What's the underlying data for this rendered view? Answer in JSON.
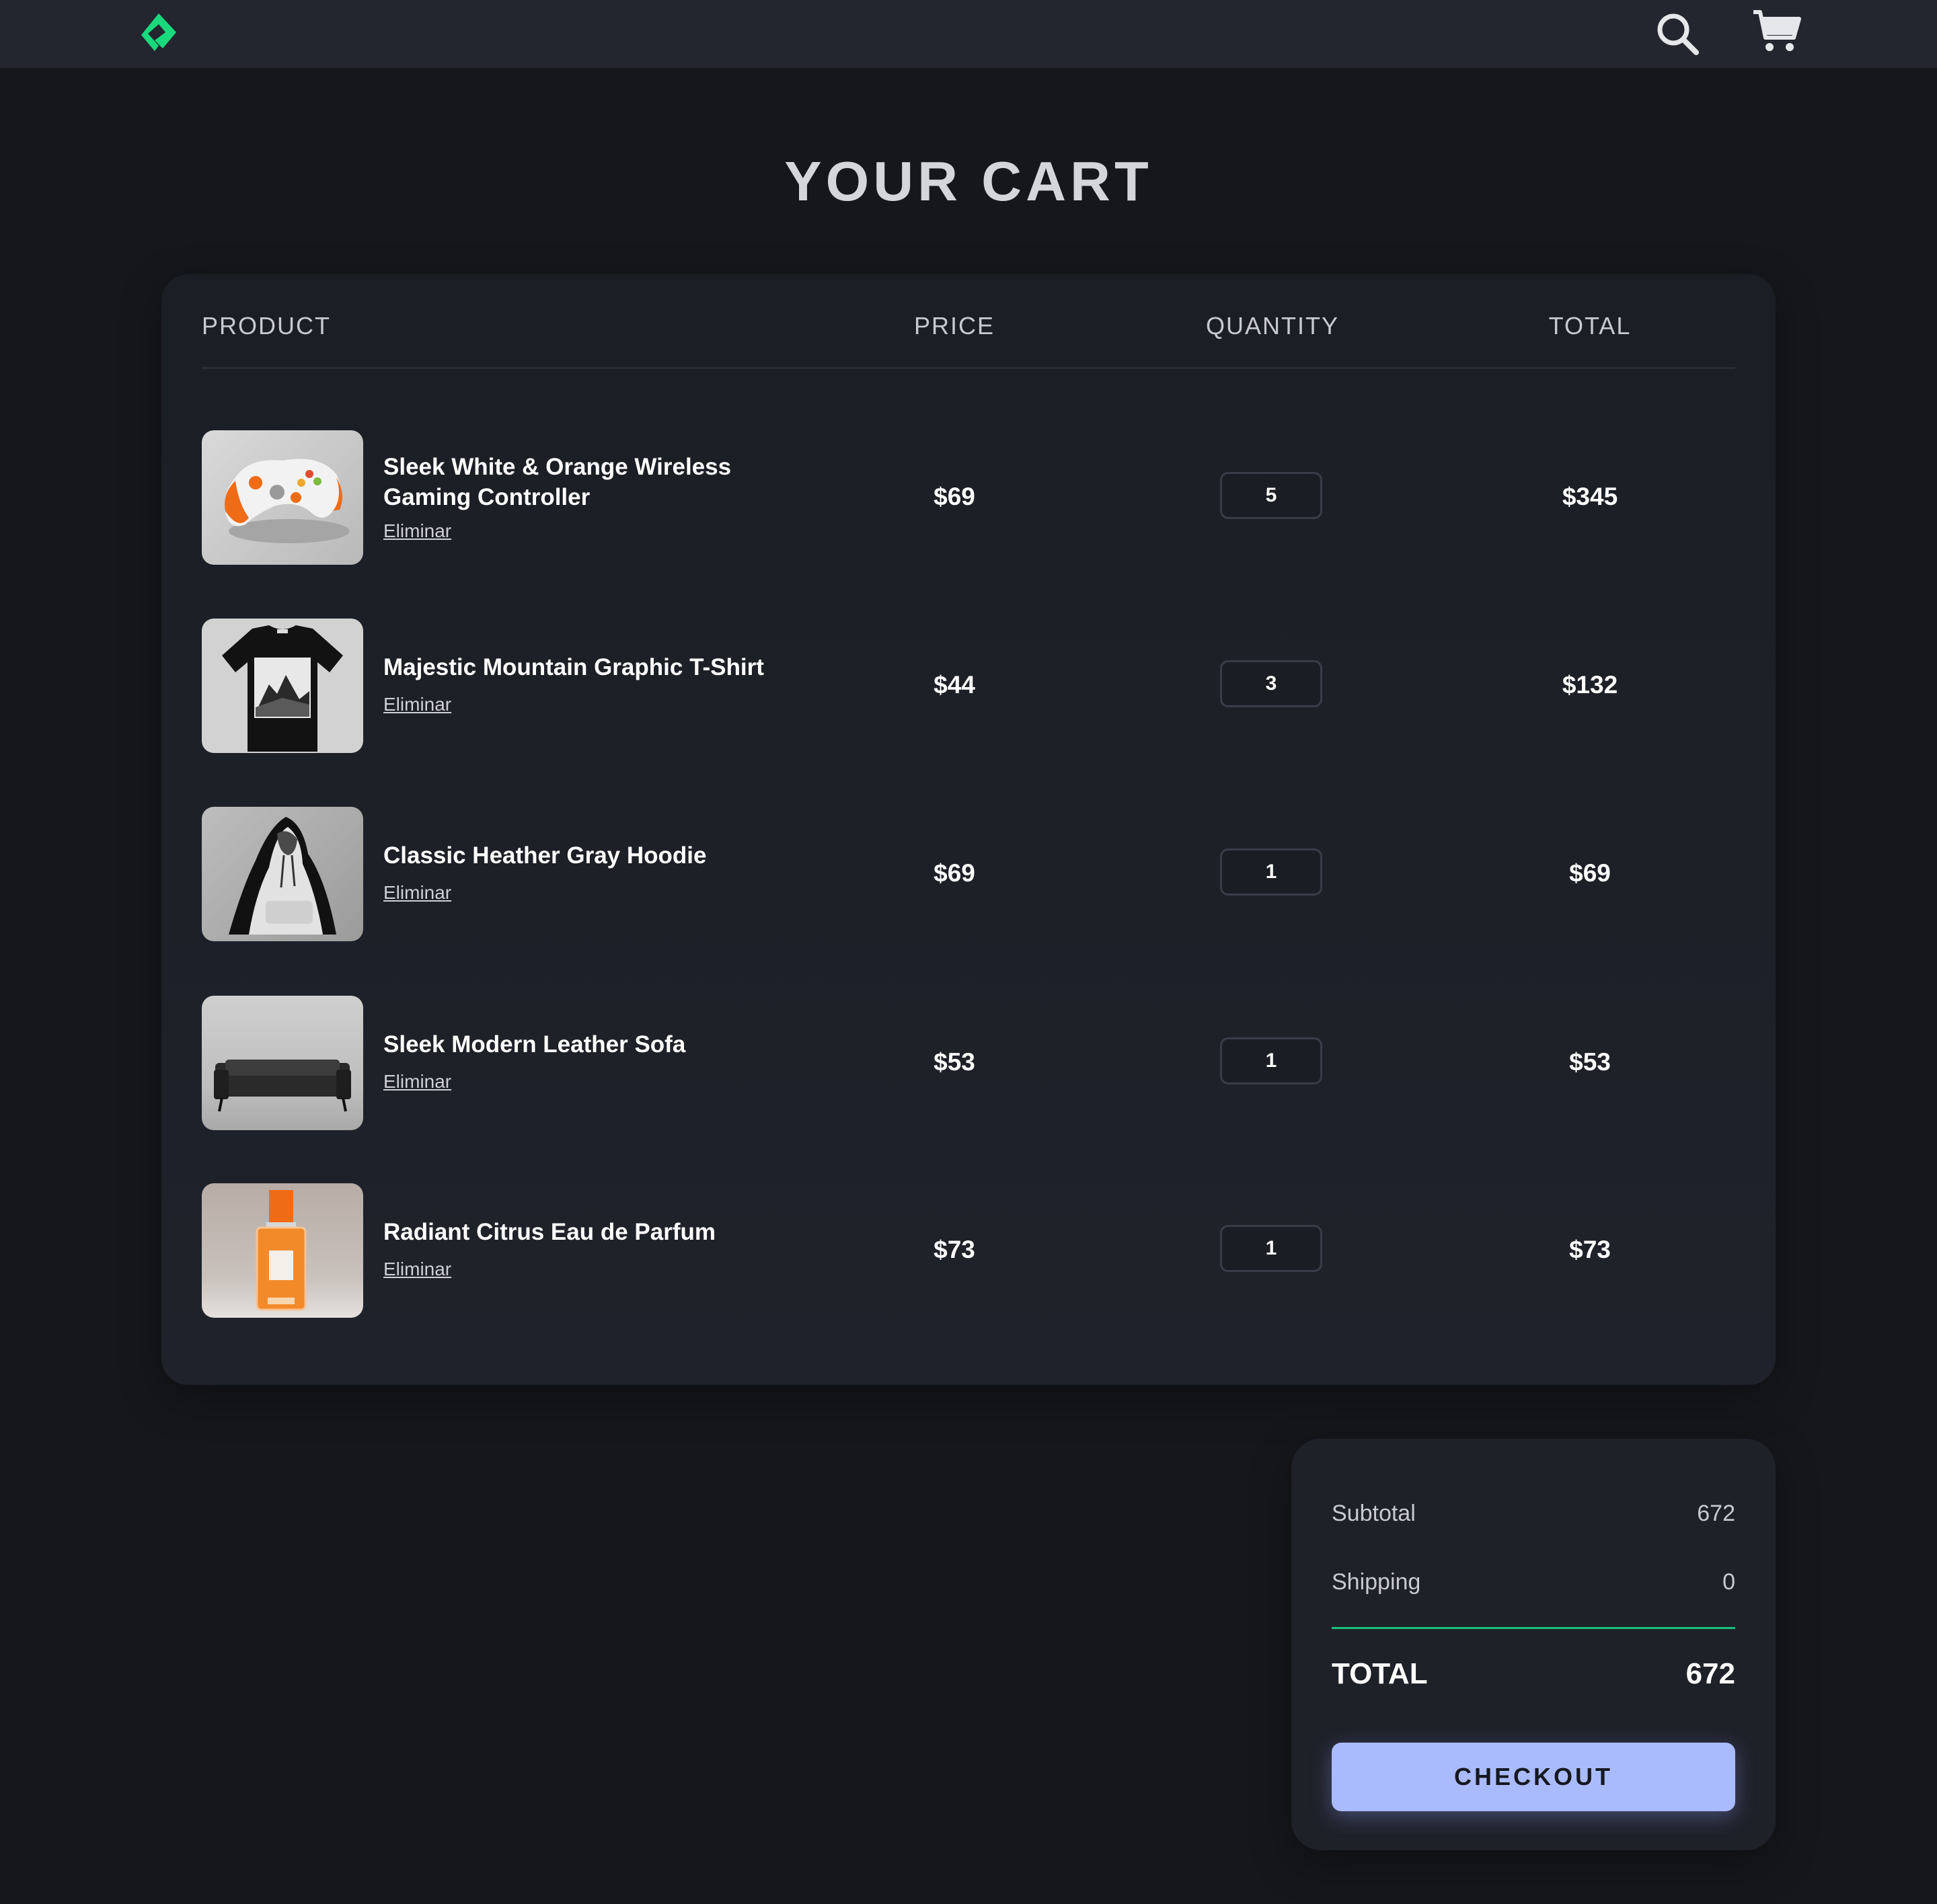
{
  "header": {
    "logo_icon": "diamond-logo-icon",
    "search_icon": "search-icon",
    "cart_icon": "cart-icon",
    "logo_color": "#19d97c"
  },
  "page": {
    "title": "YOUR CART"
  },
  "table": {
    "headers": {
      "product": "PRODUCT",
      "price": "PRICE",
      "quantity": "QUANTITY",
      "total": "TOTAL"
    },
    "rows": [
      {
        "name": "Sleek White & Orange Wireless Gaming Controller",
        "remove": "Eliminar",
        "price": "$69",
        "quantity": "5",
        "total": "$345",
        "image_icon": "gaming-controller-image"
      },
      {
        "name": "Majestic Mountain Graphic T-Shirt",
        "remove": "Eliminar",
        "price": "$44",
        "quantity": "3",
        "total": "$132",
        "image_icon": "tshirt-image"
      },
      {
        "name": "Classic Heather Gray Hoodie",
        "remove": "Eliminar",
        "price": "$69",
        "quantity": "1",
        "total": "$69",
        "image_icon": "hoodie-image"
      },
      {
        "name": "Sleek Modern Leather Sofa",
        "remove": "Eliminar",
        "price": "$53",
        "quantity": "1",
        "total": "$53",
        "image_icon": "sofa-image"
      },
      {
        "name": "Radiant Citrus Eau de Parfum",
        "remove": "Eliminar",
        "price": "$73",
        "quantity": "1",
        "total": "$73",
        "image_icon": "perfume-image"
      }
    ]
  },
  "summary": {
    "subtotal_label": "Subtotal",
    "subtotal_value": "672",
    "shipping_label": "Shipping",
    "shipping_value": "0",
    "total_label": "TOTAL",
    "total_value": "672",
    "checkout_label": "CHECKOUT",
    "accent_color": "#17c47a",
    "button_color": "#aabbfd"
  }
}
